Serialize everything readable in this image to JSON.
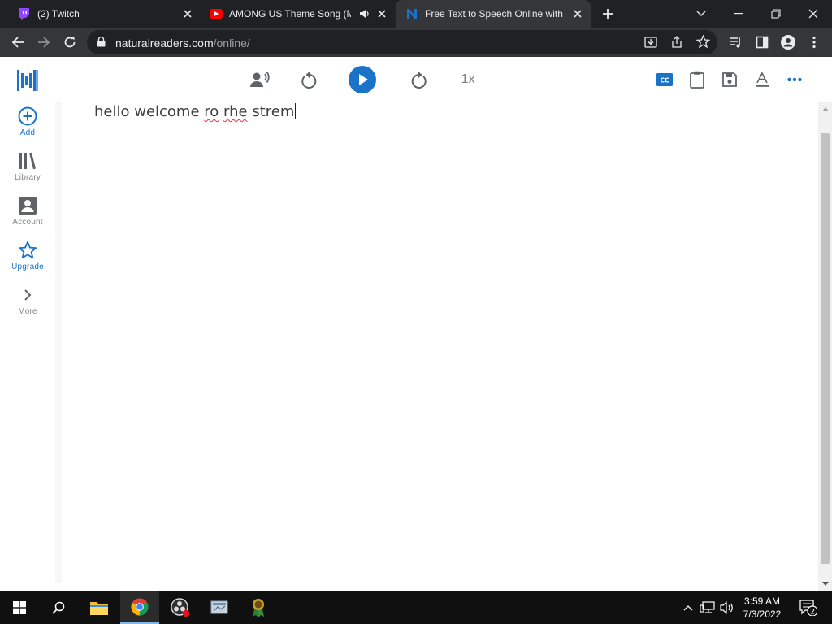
{
  "browser": {
    "tabs": [
      {
        "title": "(2) Twitch",
        "icon": "twitch-icon",
        "active": false
      },
      {
        "title": "AMONG US Theme Song (M",
        "icon": "youtube-icon",
        "active": false,
        "playing_audio": true
      },
      {
        "title": "Free Text to Speech Online with A",
        "icon": "naturalreader-icon",
        "active": true
      }
    ],
    "url": {
      "domain": "naturalreaders.com",
      "path": "/online/"
    }
  },
  "app": {
    "sidebar": [
      {
        "id": "add",
        "label": "Add",
        "icon": "add-circle-icon"
      },
      {
        "id": "library",
        "label": "Library",
        "icon": "library-icon"
      },
      {
        "id": "account",
        "label": "Account",
        "icon": "account-icon"
      },
      {
        "id": "upgrade",
        "label": "Upgrade",
        "icon": "star-icon"
      },
      {
        "id": "more",
        "label": "More",
        "icon": "chevron-right-icon"
      }
    ],
    "player": {
      "speed": "1x"
    },
    "document": {
      "segments": [
        {
          "text": "hello welcome ",
          "misspelled": false
        },
        {
          "text": "ro",
          "misspelled": true
        },
        {
          "text": " ",
          "misspelled": false
        },
        {
          "text": "rhe",
          "misspelled": true
        },
        {
          "text": " strem",
          "misspelled": false
        }
      ]
    }
  },
  "taskbar": {
    "time": "3:59 AM",
    "date": "7/3/2022",
    "notification_count": "2"
  },
  "colors": {
    "accent": "#1a73c8",
    "chrome_dark": "#202124",
    "chrome_toolbar": "#35363a",
    "taskbar": "#101010"
  }
}
